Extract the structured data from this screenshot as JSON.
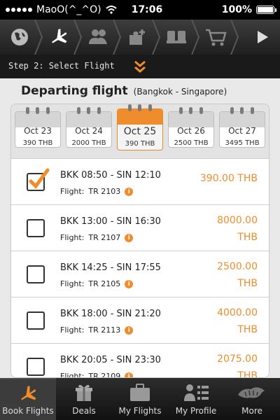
{
  "status": {
    "carrier": "MaoO(^_^O)",
    "time": "17:06",
    "battery": "100%"
  },
  "stepnav": {
    "icons": [
      "globe-icon",
      "plane-icon",
      "passengers-icon",
      "addons-icon",
      "seats-icon",
      "cart-icon",
      "next-icon"
    ],
    "step_label": "Step 2: Select Flight"
  },
  "heading": {
    "title": "Departing flight",
    "route": "(Bangkok - Singapore)"
  },
  "dates": [
    {
      "date": "Oct 23",
      "price": "390 THB"
    },
    {
      "date": "Oct 24",
      "price": "2000 THB"
    },
    {
      "date": "Oct 25",
      "price": "390 THB",
      "selected": true
    },
    {
      "date": "Oct 26",
      "price": "2500 THB"
    },
    {
      "date": "Oct 27",
      "price": "3495 THB"
    }
  ],
  "flights": [
    {
      "times": "BKK 08:50 - SIN 12:10",
      "flight_label": "Flight:",
      "flight_no": "TR 2103",
      "price_line1": "390.00 THB",
      "price_line2": "",
      "checked": true
    },
    {
      "times": "BKK 13:00 - SIN 16:30",
      "flight_label": "Flight:",
      "flight_no": "TR 2107",
      "price_line1": "8000.00",
      "price_line2": "THB",
      "checked": false
    },
    {
      "times": "BKK 14:25 - SIN 17:55",
      "flight_label": "Flight:",
      "flight_no": "TR 2105",
      "price_line1": "2500.00",
      "price_line2": "THB",
      "checked": false
    },
    {
      "times": "BKK 18:00 - SIN 21:20",
      "flight_label": "Flight:",
      "flight_no": "TR 2113",
      "price_line1": "4000.00",
      "price_line2": "THB",
      "checked": false
    },
    {
      "times": "BKK 20:05 - SIN 23:30",
      "flight_label": "Flight:",
      "flight_no": "TR 2109",
      "price_line1": "2075.00",
      "price_line2": "THB",
      "checked": false
    }
  ],
  "tabs": [
    "Book Flights",
    "Deals",
    "My Flights",
    "My Profile",
    "More"
  ],
  "colors": {
    "accent": "#ef8c2c",
    "dark": "#1a1a1a"
  }
}
